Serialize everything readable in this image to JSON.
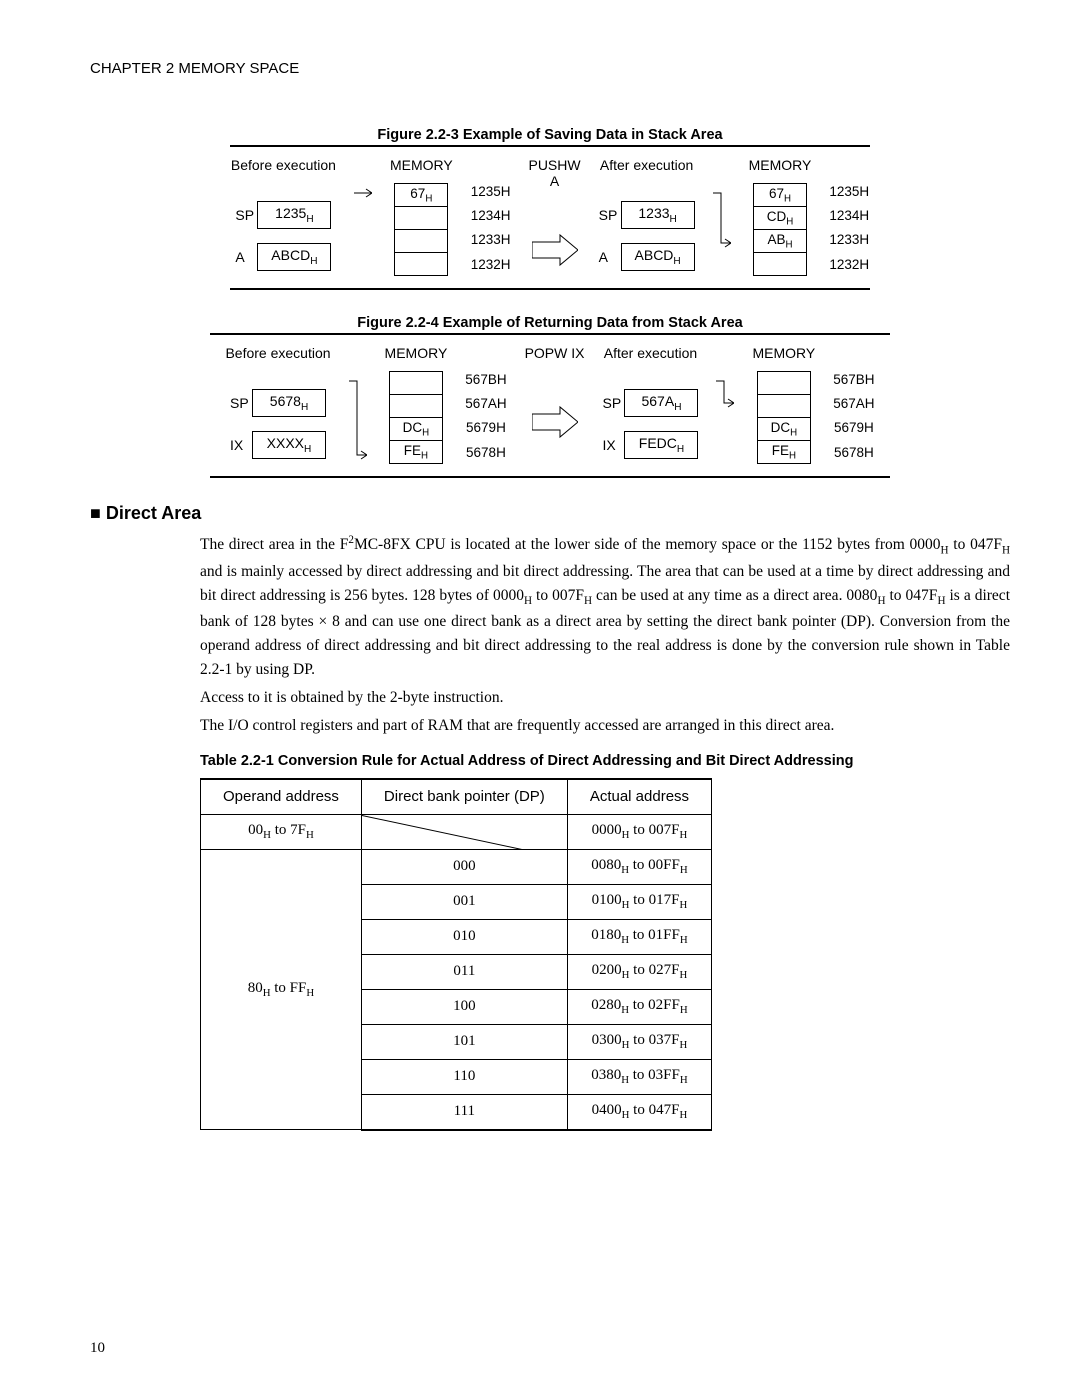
{
  "chapter_heading": "CHAPTER 2  MEMORY SPACE",
  "figure23": {
    "caption": "Figure 2.2-3  Example of Saving Data in Stack Area",
    "before_label": "Before execution",
    "after_label": "After execution",
    "memory_label": "MEMORY",
    "op_label": "PUSHW A",
    "before": {
      "regs": [
        {
          "name": "SP",
          "val": "1235",
          "suffix": "H"
        },
        {
          "name": "A",
          "val": "ABCD",
          "suffix": "H"
        }
      ],
      "mem_vals": [
        "67",
        "",
        "",
        ""
      ],
      "mem_addrs": [
        "1235",
        "1234",
        "1233",
        "1232"
      ]
    },
    "after": {
      "regs": [
        {
          "name": "SP",
          "val": "1233",
          "suffix": "H"
        },
        {
          "name": "A",
          "val": "ABCD",
          "suffix": "H"
        }
      ],
      "mem_vals": [
        "67",
        "CD",
        "AB",
        ""
      ],
      "mem_addrs": [
        "1235",
        "1234",
        "1233",
        "1232"
      ]
    }
  },
  "figure24": {
    "caption": "Figure 2.2-4  Example of Returning Data from Stack Area",
    "before_label": "Before execution",
    "after_label": "After execution",
    "memory_label": "MEMORY",
    "op_label": "POPW IX",
    "before": {
      "regs": [
        {
          "name": "SP",
          "val": "5678",
          "suffix": "H"
        },
        {
          "name": "IX",
          "val": "XXXX",
          "suffix": "H"
        }
      ],
      "mem_vals": [
        "",
        "",
        "DC",
        "FE"
      ],
      "mem_addrs": [
        "567B",
        "567A",
        "5679",
        "5678"
      ]
    },
    "after": {
      "regs": [
        {
          "name": "SP",
          "val": "567A",
          "suffix": "H"
        },
        {
          "name": "IX",
          "val": "FEDC",
          "suffix": "H"
        }
      ],
      "mem_vals": [
        "",
        "",
        "DC",
        "FE"
      ],
      "mem_addrs": [
        "567B",
        "567A",
        "5679",
        "5678"
      ]
    }
  },
  "section_heading": "■ Direct Area",
  "body": {
    "p1a": "The direct area in the F",
    "p1b": "MC-8FX CPU is located at the lower side of the memory space or the 1152 bytes from 0000",
    "p1c": " to 047F",
    "p1d": " and is mainly accessed by direct addressing and bit direct addressing. The area that can be used at a time by direct addressing and bit direct addressing is 256 bytes. 128 bytes of 0000",
    "p1e": " to 007F",
    "p1f": " can be used at any time as a direct area. 0080",
    "p1g": " to 047F",
    "p1h": " is a direct bank of 128 bytes × 8 and can use one direct bank as a direct area by setting the direct bank pointer (DP). Conversion from the operand address of direct addressing and bit direct addressing to the real address is done by the conversion rule shown in Table 2.2-1 by using DP.",
    "p2": "Access to it is obtained by the 2-byte instruction.",
    "p3": "The I/O control registers and part of RAM that are frequently accessed are arranged in this direct area."
  },
  "table": {
    "caption": "Table 2.2-1  Conversion Rule for Actual Address of Direct Addressing and Bit Direct Addressing",
    "headers": [
      "Operand address",
      "Direct bank pointer (DP)",
      "Actual address"
    ],
    "row1": {
      "op": "00H to 7FH",
      "actual": "0000H to 007FH"
    },
    "group_op": "80H to FFH",
    "rows": [
      {
        "dp": "000",
        "actual": "0080H to 00FFH"
      },
      {
        "dp": "001",
        "actual": "0100H to 017FH"
      },
      {
        "dp": "010",
        "actual": "0180H to 01FFH"
      },
      {
        "dp": "011",
        "actual": "0200H to 027FH"
      },
      {
        "dp": "100",
        "actual": "0280H to 02FFH"
      },
      {
        "dp": "101",
        "actual": "0300H to 037FH"
      },
      {
        "dp": "110",
        "actual": "0380H to 03FFH"
      },
      {
        "dp": "111",
        "actual": "0400H to 047FH"
      }
    ]
  },
  "page_number": "10"
}
